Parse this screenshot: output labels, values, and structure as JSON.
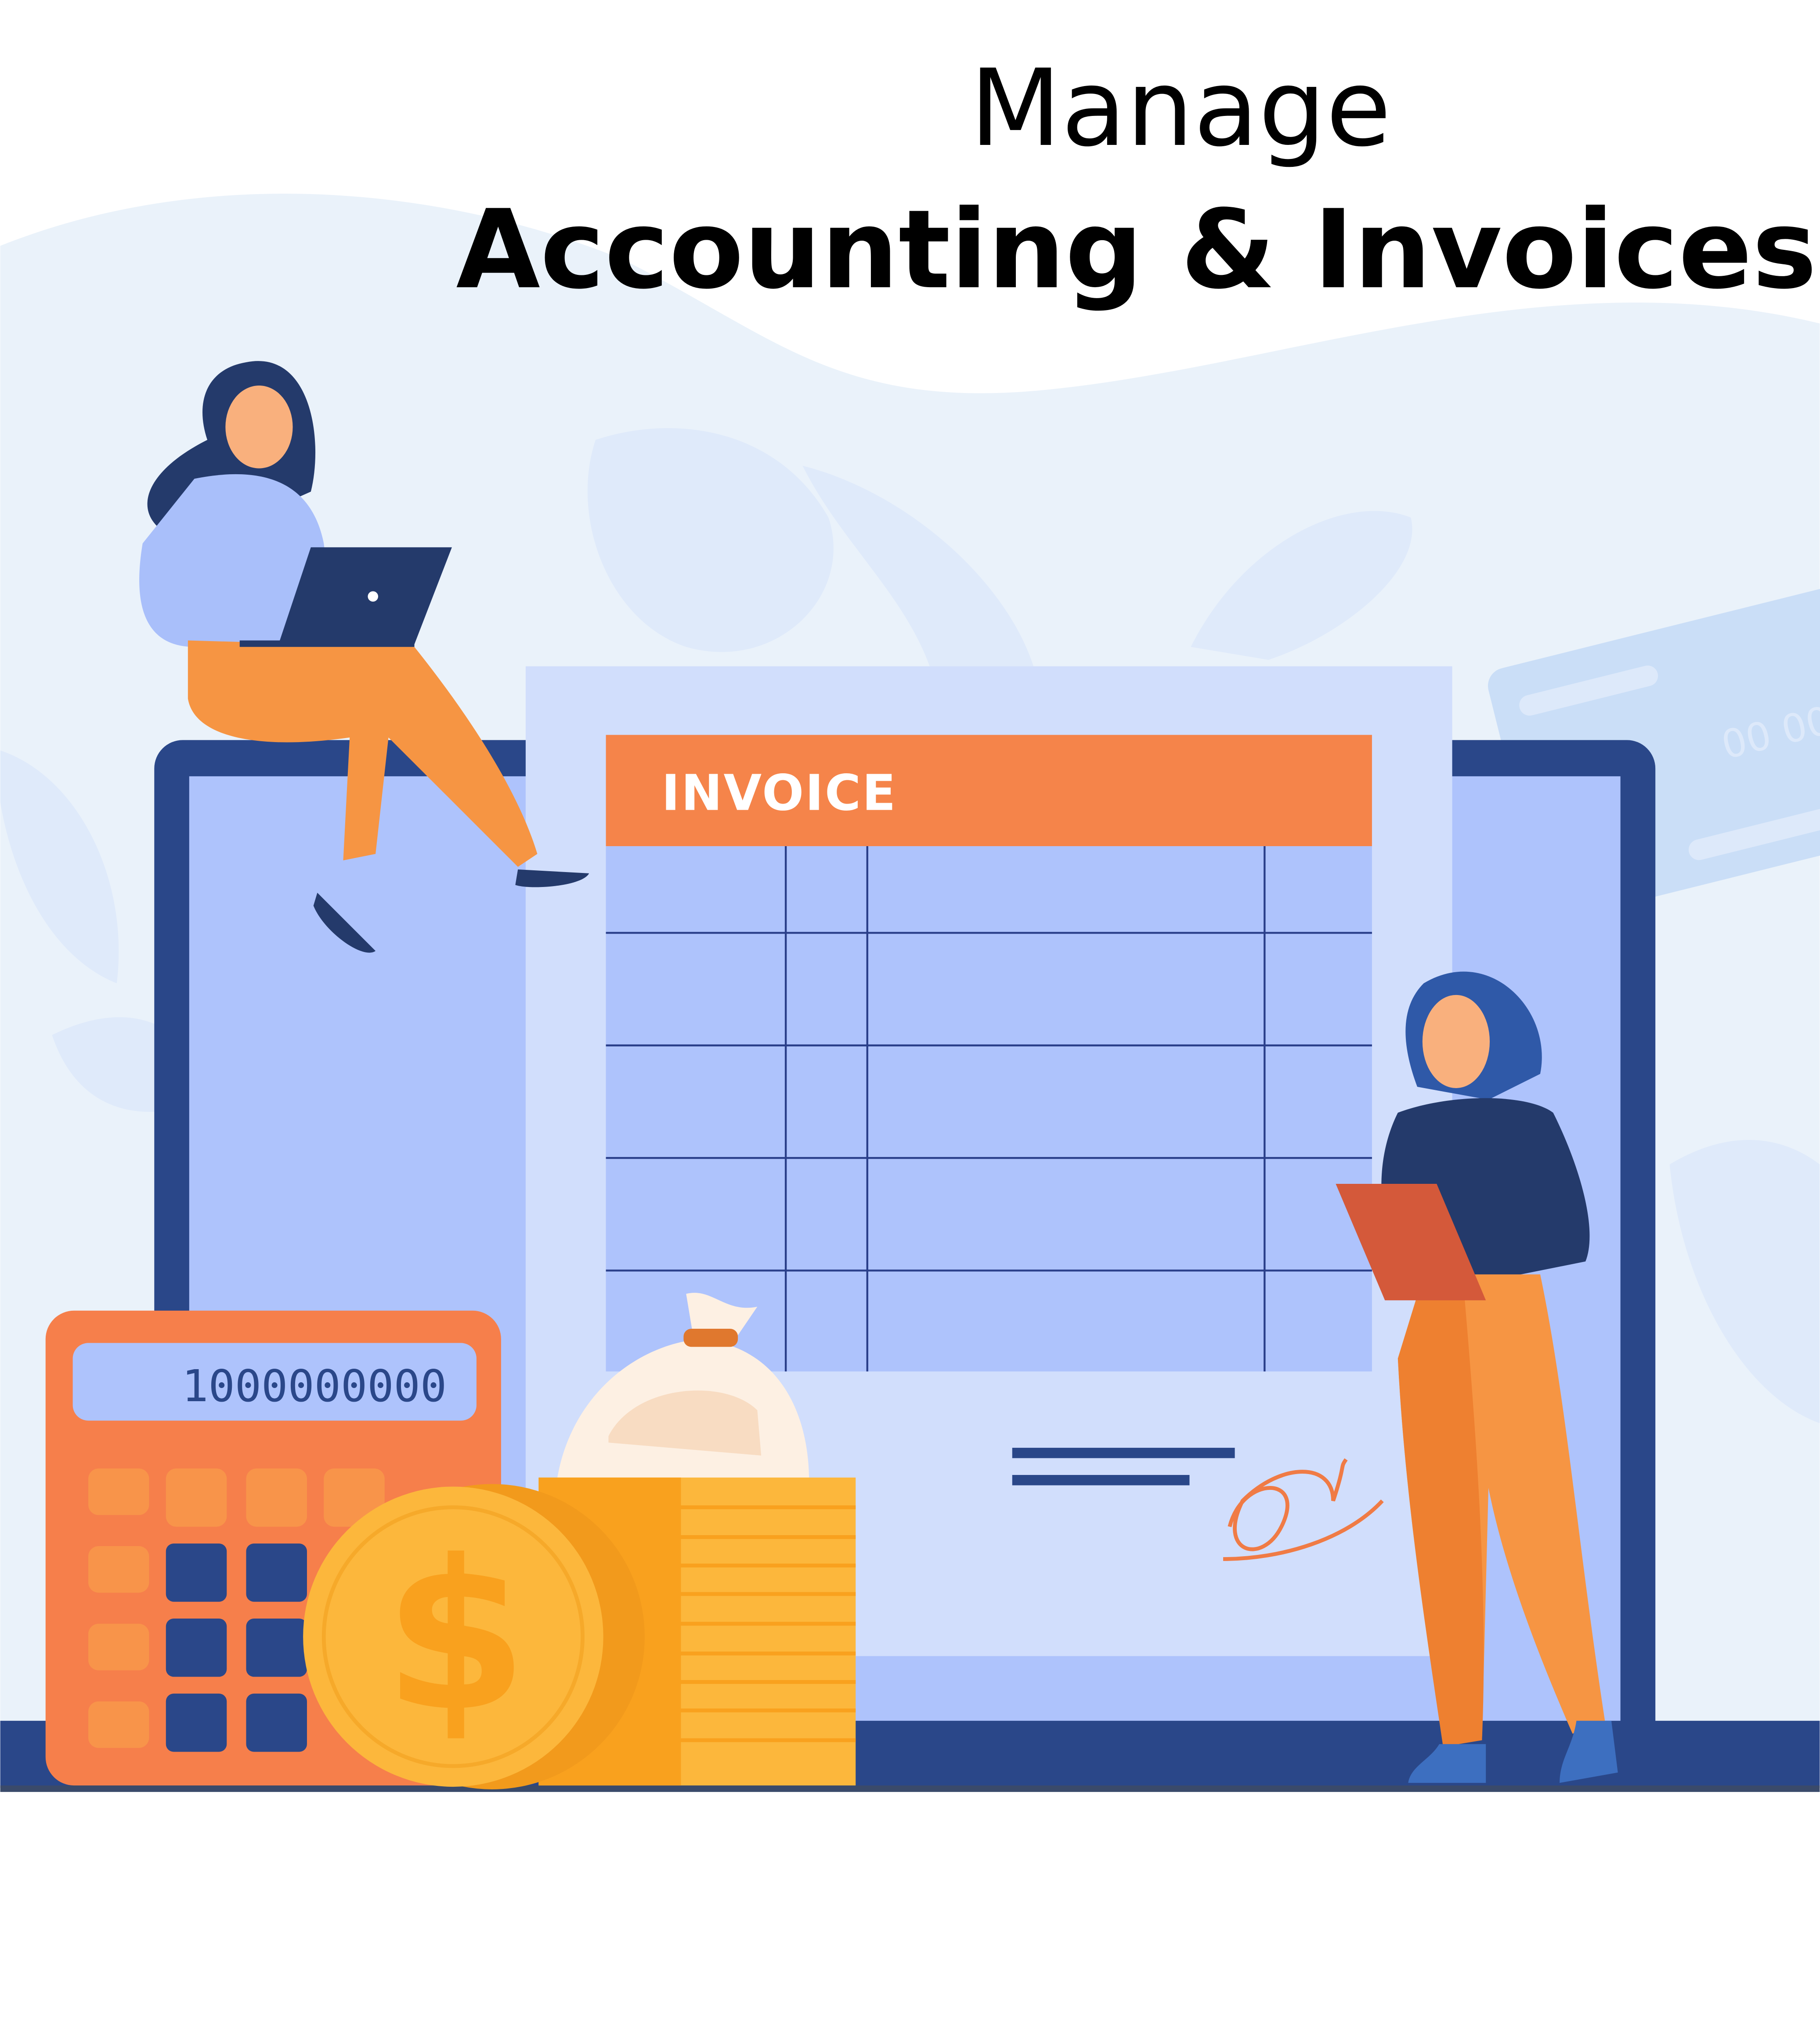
{
  "heading": {
    "line1": "Manage",
    "line2": "Accounting & Invoices"
  },
  "invoice": {
    "title": "INVOICE",
    "table_rows": 6,
    "table_columns": 4
  },
  "calculator": {
    "display": "1000000000"
  },
  "credit_card": {
    "number_fragment": "00 00"
  },
  "colors": {
    "background_wave": "#eaf2fa",
    "laptop_frame": "#2a4789",
    "laptop_screen": "#aec3fc",
    "invoice_paper": "#d1defc",
    "invoice_header": "#f5844a",
    "calculator_body": "#f67f4b",
    "coin": "#fcb73c",
    "shirt_light": "#a9bffa",
    "pants_orange": "#f69543"
  },
  "icons": [
    "dollar-coin-icon",
    "money-bag-icon",
    "laptop-icon",
    "clipboard-icon",
    "signature-icon"
  ]
}
